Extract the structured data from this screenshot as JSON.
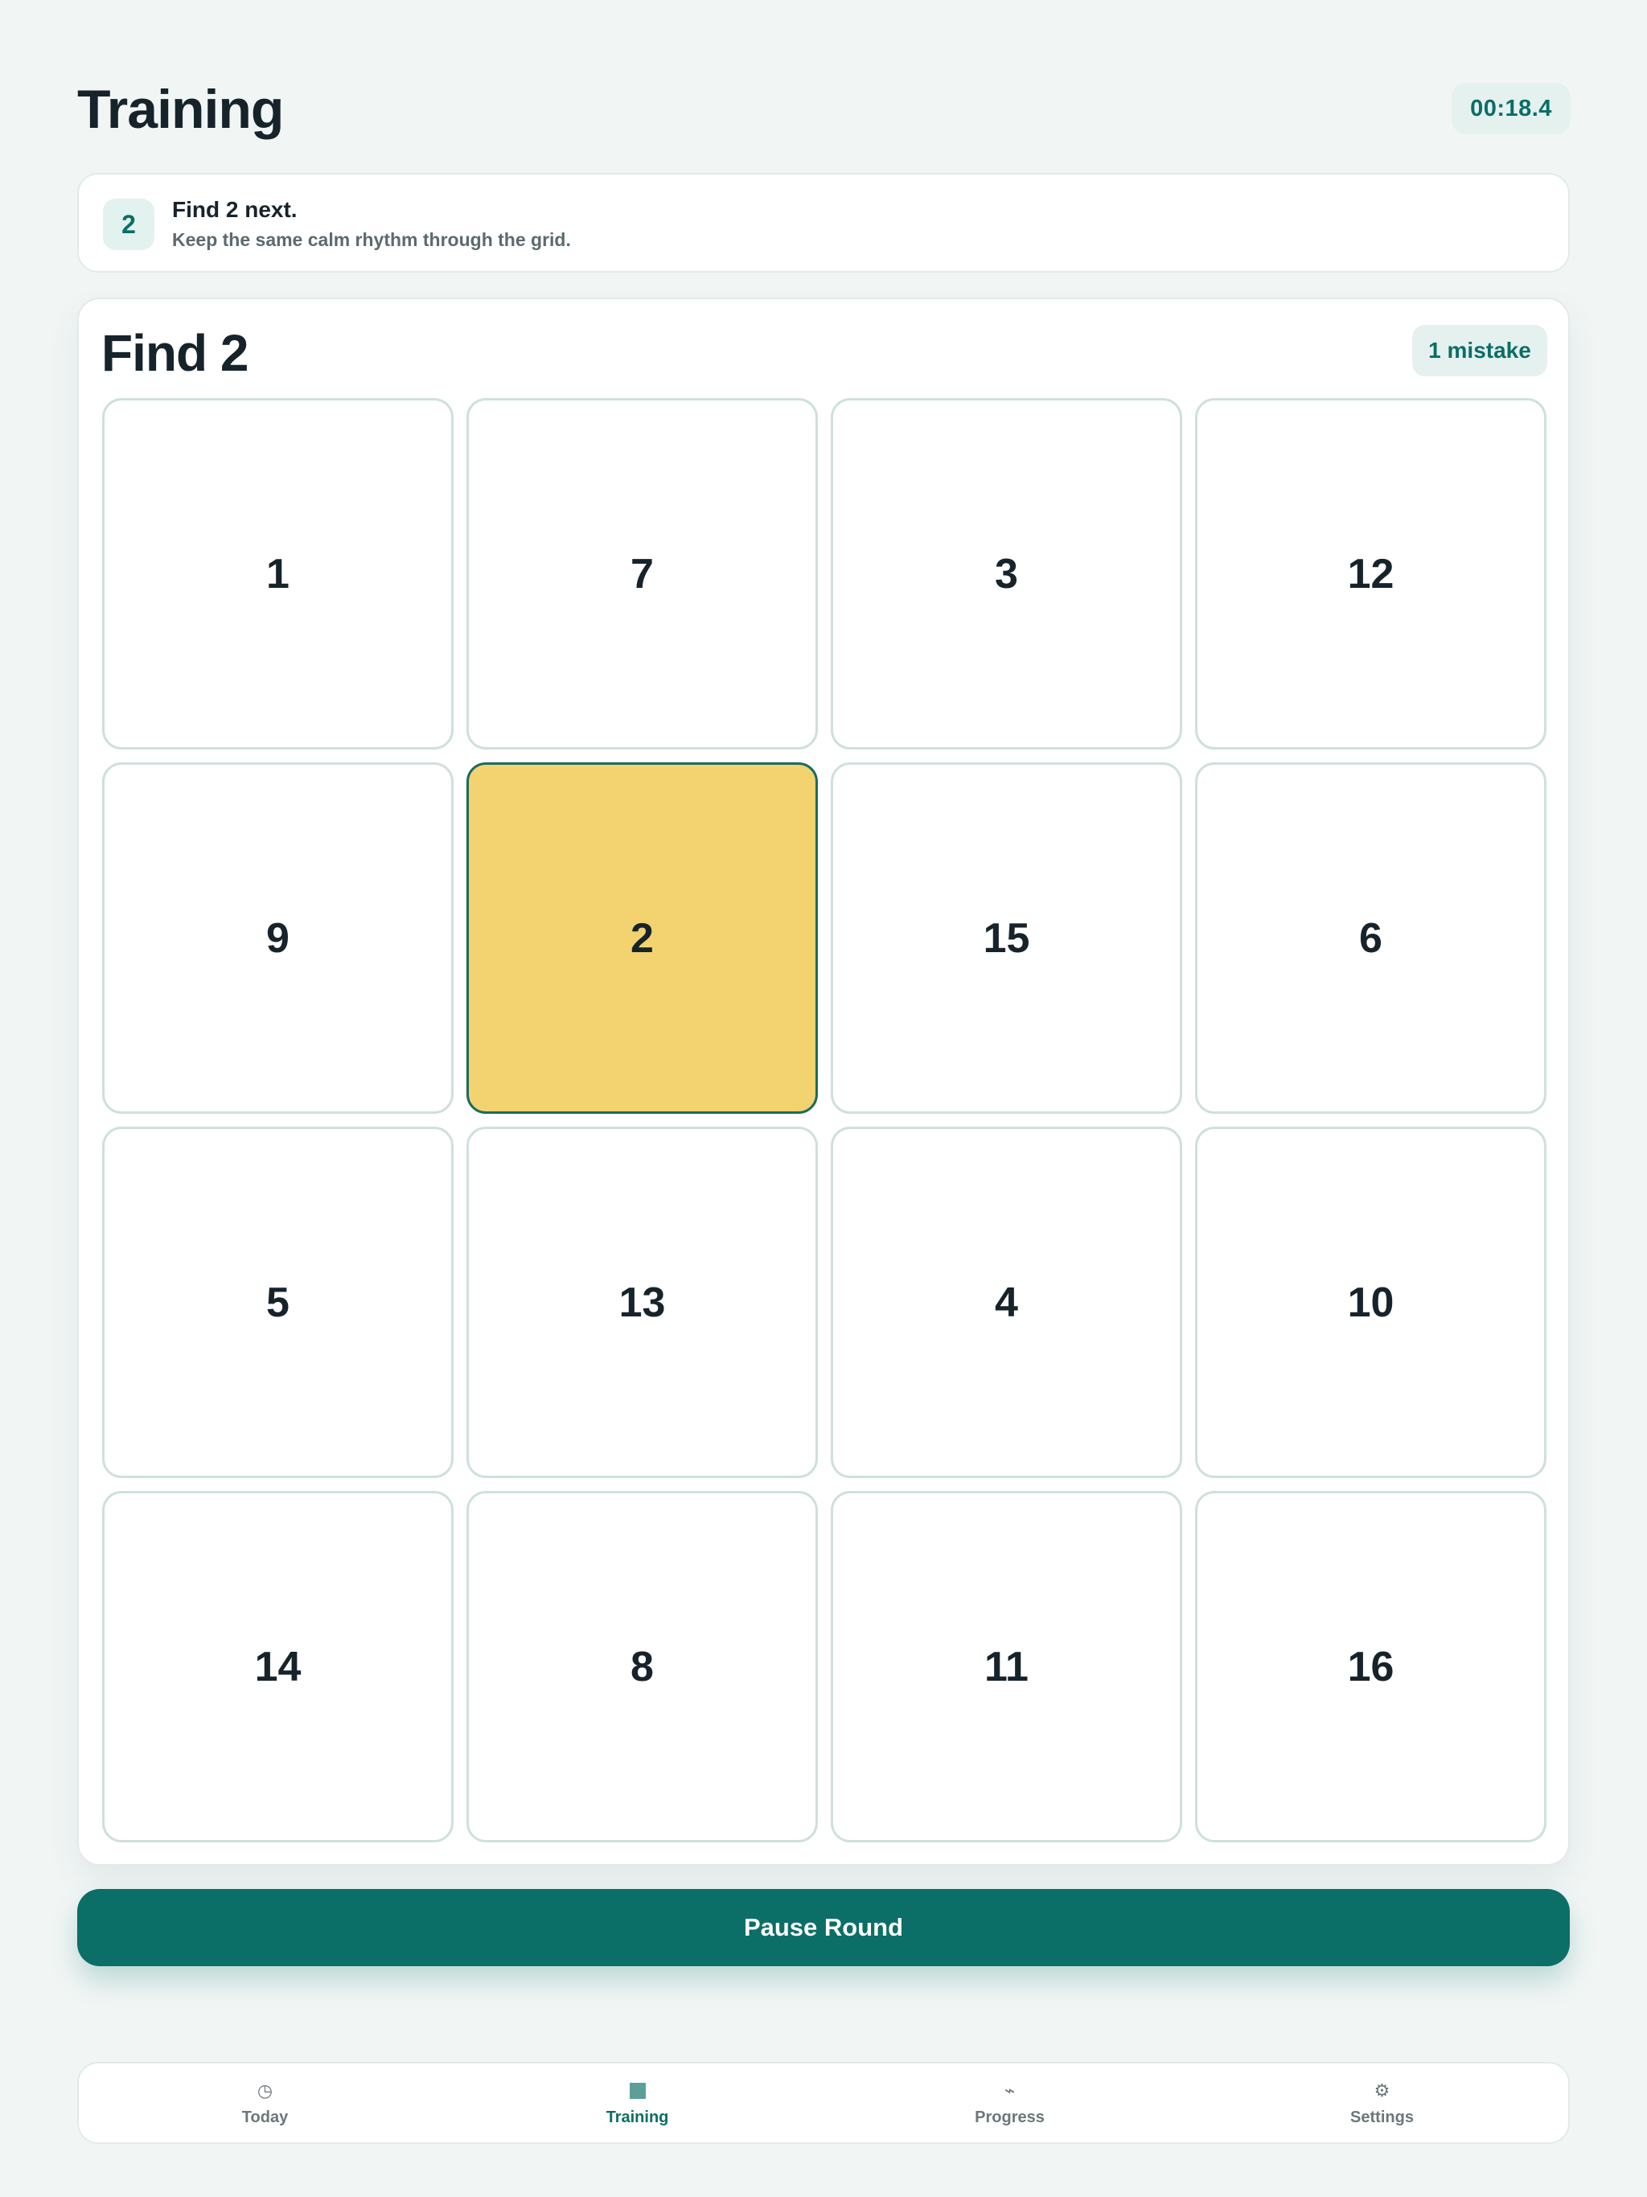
{
  "header": {
    "title": "Training",
    "timer": "00:18.4"
  },
  "hint": {
    "badge": "2",
    "title": "Find 2 next.",
    "subtitle": "Keep the same calm rhythm through the grid."
  },
  "board": {
    "title": "Find 2",
    "mistakes": "1 mistake",
    "highlight_color": "#f2d36f",
    "tiles": [
      "1",
      "7",
      "3",
      "12",
      "9",
      "2",
      "15",
      "6",
      "5",
      "13",
      "4",
      "10",
      "14",
      "8",
      "11",
      "16"
    ],
    "highlighted_tile": "2"
  },
  "actions": {
    "pause_label": "Pause Round"
  },
  "tabs": [
    {
      "label": "Today",
      "icon": "clock-icon",
      "glyph": "◷"
    },
    {
      "label": "Training",
      "icon": "grid-square-icon",
      "glyph": ""
    },
    {
      "label": "Progress",
      "icon": "zigzag-icon",
      "glyph": "⌁"
    },
    {
      "label": "Settings",
      "icon": "gear-icon",
      "glyph": "⚙"
    }
  ],
  "active_tab": "Training",
  "colors": {
    "accent": "#0b6e67",
    "background": "#f1f6f5"
  }
}
